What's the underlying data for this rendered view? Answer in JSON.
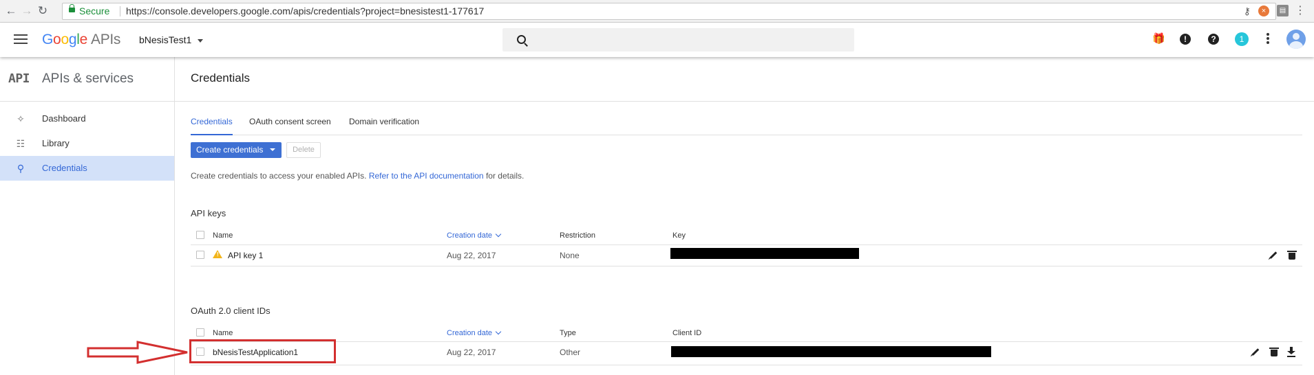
{
  "browser": {
    "secure_label": "Secure",
    "url": "https://console.developers.google.com/apis/credentials?project=bnesistest1-177617"
  },
  "header": {
    "logo_google": "Google",
    "logo_apis": "APIs",
    "project_name": "bNesisTest1",
    "notification_count": "1"
  },
  "sidebar": {
    "glyph": "API",
    "title": "APIs & services",
    "items": [
      {
        "label": "Dashboard",
        "icon": "dashboard-icon"
      },
      {
        "label": "Library",
        "icon": "library-icon"
      },
      {
        "label": "Credentials",
        "icon": "key-icon",
        "active": true
      }
    ]
  },
  "main": {
    "title": "Credentials",
    "tabs": [
      {
        "label": "Credentials",
        "active": true
      },
      {
        "label": "OAuth consent screen"
      },
      {
        "label": "Domain verification"
      }
    ],
    "create_button": "Create credentials",
    "delete_button": "Delete",
    "hint_prefix": "Create credentials to access your enabled APIs.",
    "hint_link": "Refer to the API documentation",
    "hint_suffix": "for details."
  },
  "api_keys": {
    "title": "API keys",
    "columns": [
      "Name",
      "Creation date",
      "Restriction",
      "Key"
    ],
    "rows": [
      {
        "name": "API key 1",
        "date": "Aug 22, 2017",
        "restriction": "None"
      }
    ]
  },
  "oauth": {
    "title": "OAuth 2.0 client IDs",
    "columns": [
      "Name",
      "Creation date",
      "Type",
      "Client ID"
    ],
    "rows": [
      {
        "name": "bNesisTestApplication1",
        "date": "Aug 22, 2017",
        "type": "Other"
      }
    ]
  },
  "colors": {
    "accent": "#3367d6",
    "annotation": "#d32f2f"
  }
}
